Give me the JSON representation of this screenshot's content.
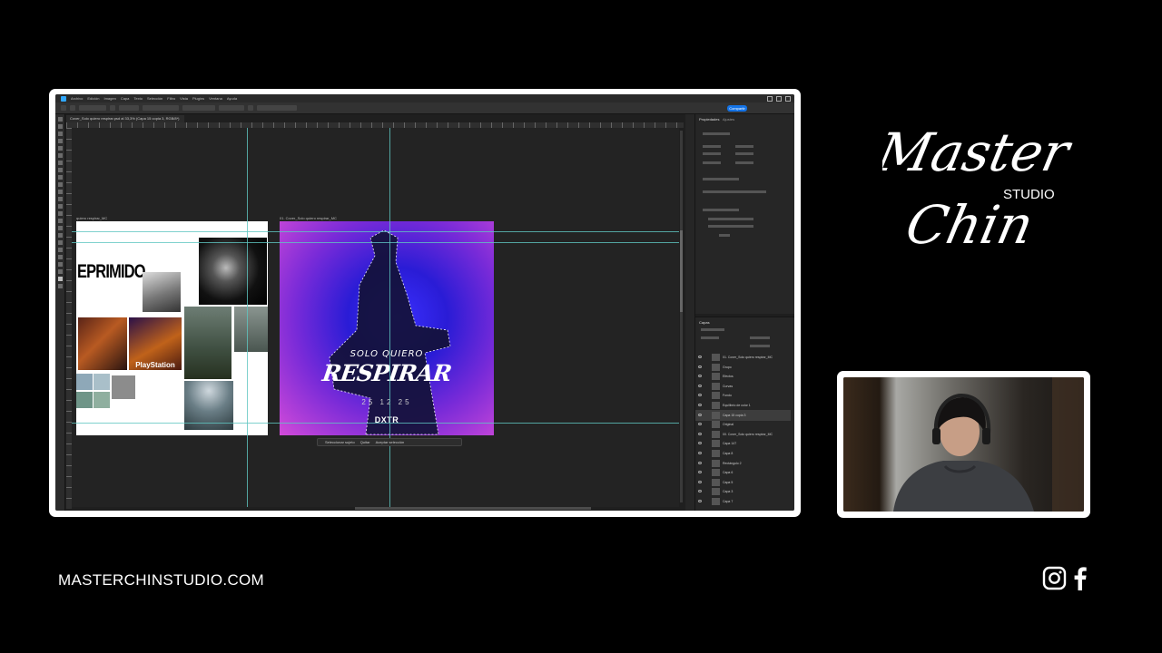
{
  "app": {
    "menu_items": [
      "Archivo",
      "Edición",
      "Imagen",
      "Capa",
      "Texto",
      "Selección",
      "Filtro",
      "Vista",
      "Plugins",
      "Ventana",
      "Ayuda"
    ],
    "share_label": "Compartir",
    "document_tab": "Cover_Solo quiero respirar.psd al 33,3% (Capa 15 copia 3, RGB/8*)",
    "moodboard_label": "quiero respirar_MC",
    "cover_label": "01. Cover_Solo quiero respirar_MC",
    "context_bar": {
      "select_subject": "Seleccionar sujeto",
      "deselect": "Quitar",
      "finish": "Aceptar selección"
    }
  },
  "moodboard": {
    "title": "EPRIMIDO",
    "console_label": "PlayStation",
    "swatch_colors": [
      "#8ea8b8",
      "#a9bfc9",
      "#8c8c8c",
      "#6f9588",
      "#8faf9f"
    ]
  },
  "cover": {
    "subtitle": "SOLO QUIERO",
    "title": "RESPIRAR",
    "date": "25 12 25",
    "brand": "DXTR",
    "colors": {
      "core": "#2a1cd6",
      "edge": "#d44bd9"
    }
  },
  "panels": {
    "properties_tab": "Propiedades",
    "adjustments_tab": "Ajustes",
    "layers_tab": "Capas",
    "layers": [
      {
        "name": "01. Cover_Solo quiero respirar_MC"
      },
      {
        "name": "Grupo"
      },
      {
        "name": "Efectos"
      },
      {
        "name": "Curvas"
      },
      {
        "name": "Fondo"
      },
      {
        "name": "Equilibrio de color 1"
      },
      {
        "name": "Capa 15 copia 3",
        "selected": true
      },
      {
        "name": "Original"
      },
      {
        "name": "00. Cover_Solo quiero respirar_MC"
      },
      {
        "name": "Capa 147"
      },
      {
        "name": "Capa 8"
      },
      {
        "name": "Rectángulo 2"
      },
      {
        "name": "Capa 6"
      },
      {
        "name": "Capa 5"
      },
      {
        "name": "Capa 3"
      },
      {
        "name": "Capa 7"
      }
    ]
  },
  "branding": {
    "logo_word1": "Master",
    "logo_word2": "Chin",
    "logo_studio": "STUDIO",
    "website": "MASTERCHINSTUDIO.COM"
  }
}
